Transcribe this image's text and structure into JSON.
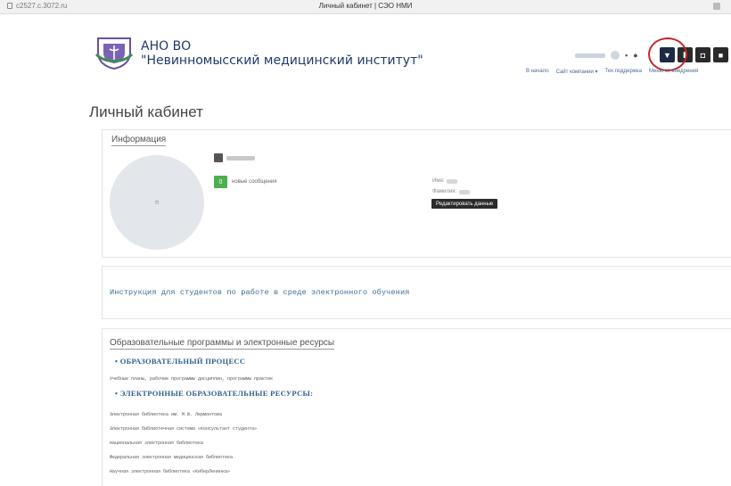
{
  "browser": {
    "url": "c2527.c.3072.ru",
    "tab_title": "Личный кабинет | СЭО НМИ"
  },
  "header": {
    "org_name": "АНО ВО",
    "institute_name": "\"Невинномысский медицинский институт\"",
    "nav": [
      "В начало",
      "Сайт компании ▾",
      "Тех.поддержка",
      "Меню от внедрения"
    ],
    "icon_buttons": [
      "monitor-icon",
      "book-icon",
      "users-icon",
      "screen-icon"
    ]
  },
  "page": {
    "title": "Личный кабинет"
  },
  "info": {
    "heading": "Информация",
    "avatar_placeholder": "п",
    "messages_count": "0",
    "messages_label": "новые сообщения",
    "name_label": "Имя:",
    "surname_label": "Фамилия:",
    "edit_button": "Редактировать данные"
  },
  "instructions": {
    "link": "Инструкция для студентов по работе в среде электронного обучения"
  },
  "edu": {
    "heading": "Образовательные программы и электронные ресурсы",
    "section1": "• ОБРАЗОВАТЕЛЬНЫЙ ПРОЦЕСС",
    "section1_sub": "Учебные планы, рабочие программы дисциплин, программы практик",
    "section2": "• ЭЛЕКТРОННЫЕ ОБРАЗОВАТЕЛЬНЫЕ РЕСУРСЫ:",
    "links": [
      "Электронная библиотека им. М.Ю. Лермонтова",
      "Электронная библиотечная система «Консультант студента»",
      "Национальная электронная библиотека",
      "Федеральная электронная медицинская библиотека",
      "Научная электронная библиотека «КиберЛенинка»"
    ]
  },
  "colors": {
    "brand_blue": "#1f3a6d",
    "link_blue": "#3a6f97",
    "badge_green": "#4caf50",
    "highlight_red": "#c62828"
  }
}
